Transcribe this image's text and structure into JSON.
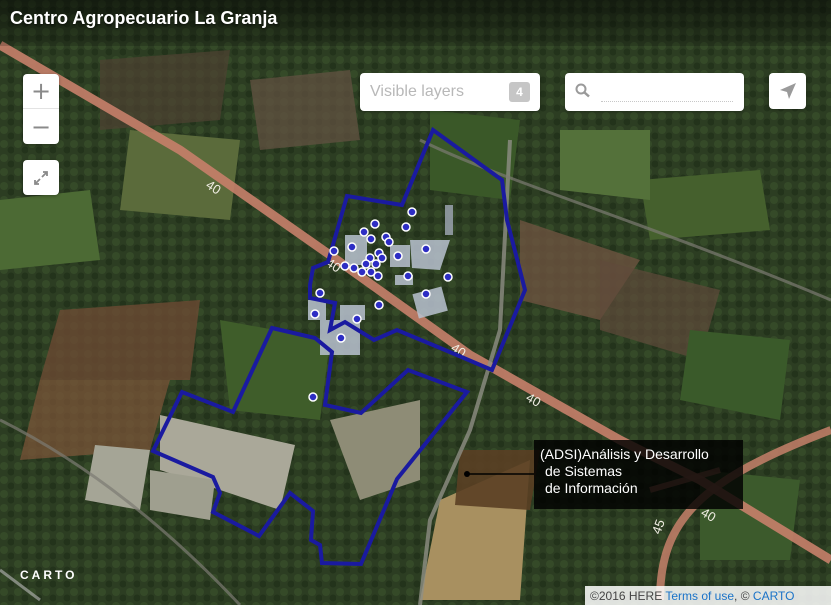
{
  "map": {
    "title": "Centro Agropecuario La Granja",
    "road_labels": [
      "40",
      "40",
      "40",
      "40",
      "40",
      "45"
    ],
    "polygon_color": "#1a1aa0",
    "point_color": "#2d2dc4",
    "road_color": "#d98a6a"
  },
  "controls": {
    "zoom_in": "+",
    "zoom_out": "−",
    "fullscreen_icon": "fullscreen-icon",
    "layers_label": "Visible layers",
    "layers_count": "4",
    "search_placeholder": "",
    "search_icon": "search-icon",
    "locate_icon": "navigation-arrow-icon"
  },
  "tooltip": {
    "line1": "(ADSI)Análisis y Desarrollo",
    "line2": "de Sistemas",
    "line3": "de Información"
  },
  "footer": {
    "logo": "CARTO",
    "attribution_prefix": "©2016 HERE",
    "terms_link": "Terms of use",
    "attribution_sep": ", ©",
    "carto_link": "CARTO"
  }
}
